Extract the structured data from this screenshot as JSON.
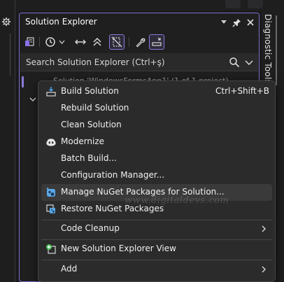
{
  "panel": {
    "title": "Solution Explorer",
    "search_placeholder": "Search Solution Explorer (Ctrl+ş)",
    "tree_row_text": "Solution 'WindowsFormsApp1' (1 of 1 project)"
  },
  "side_tab": {
    "label": "Diagnostic Tools"
  },
  "context_menu": {
    "items": [
      {
        "label": "Build Solution",
        "shortcut": "Ctrl+Shift+B",
        "icon": "build-icon"
      },
      {
        "label": "Rebuild Solution",
        "shortcut": "",
        "icon": ""
      },
      {
        "label": "Clean Solution",
        "shortcut": "",
        "icon": ""
      },
      {
        "label": "Modernize",
        "shortcut": "",
        "icon": "copilot-icon"
      },
      {
        "label": "Batch Build...",
        "shortcut": "",
        "icon": ""
      },
      {
        "label": "Configuration Manager...",
        "shortcut": "",
        "icon": ""
      },
      {
        "label": "Manage NuGet Packages for Solution...",
        "shortcut": "",
        "icon": "nuget-icon"
      },
      {
        "label": "Restore NuGet Packages",
        "shortcut": "",
        "icon": "restore-icon"
      },
      {
        "label": "Code Cleanup",
        "shortcut": "",
        "icon": "",
        "submenu": true
      },
      {
        "label": "New Solution Explorer View",
        "shortcut": "",
        "icon": "new-view-icon"
      },
      {
        "label": "Add",
        "shortcut": "",
        "icon": "",
        "submenu": true
      }
    ]
  },
  "watermark": "www.digitaldevs.com",
  "colors": {
    "accent": "#8a7ad8",
    "menu_bg": "#2b2b2b",
    "hover_bg": "#3a3a3a",
    "panel_bg": "#1f1f1f"
  }
}
